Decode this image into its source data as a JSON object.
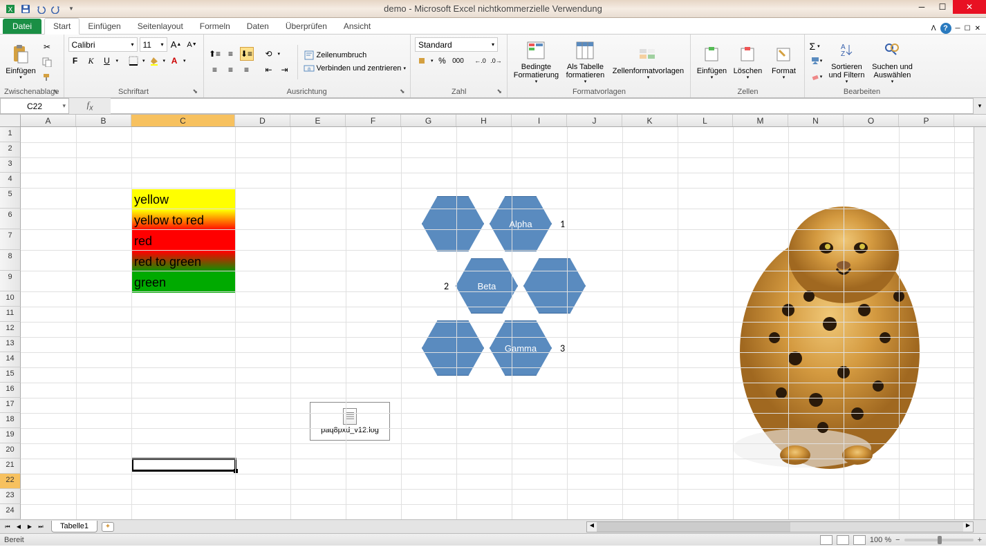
{
  "title": "demo  -  Microsoft Excel nichtkommerzielle Verwendung",
  "tabs": {
    "file": "Datei",
    "items": [
      "Start",
      "Einfügen",
      "Seitenlayout",
      "Formeln",
      "Daten",
      "Überprüfen",
      "Ansicht"
    ],
    "active": 0
  },
  "ribbon": {
    "clipboard": {
      "label": "Zwischenablage",
      "paste": "Einfügen"
    },
    "font": {
      "label": "Schriftart",
      "name": "Calibri",
      "size": "11"
    },
    "alignment": {
      "label": "Ausrichtung",
      "wrap": "Zeilenumbruch",
      "merge": "Verbinden und zentrieren"
    },
    "number": {
      "label": "Zahl",
      "format": "Standard"
    },
    "styles": {
      "label": "Formatvorlagen",
      "conditional": "Bedingte Formatierung",
      "table": "Als Tabelle formatieren",
      "cellstyles": "Zellenformatvorlagen"
    },
    "cells": {
      "label": "Zellen",
      "insert": "Einfügen",
      "delete": "Löschen",
      "format": "Format"
    },
    "editing": {
      "label": "Bearbeiten",
      "sort": "Sortieren und Filtern",
      "find": "Suchen und Auswählen"
    }
  },
  "namebox": "C22",
  "columns": [
    "A",
    "B",
    "C",
    "D",
    "E",
    "F",
    "G",
    "H",
    "I",
    "J",
    "K",
    "L",
    "M",
    "N",
    "O",
    "P"
  ],
  "rows_visible": 26,
  "selected_col": "C",
  "selected_row": 22,
  "cells": {
    "c5": "yellow",
    "c6": "yellow to red",
    "c7": "red",
    "c8": "red to green",
    "c9": "green",
    "j6": "1",
    "h10": "2",
    "j14": "3"
  },
  "hex_labels": {
    "alpha": "Alpha",
    "beta": "Beta",
    "gamma": "Gamma"
  },
  "embedded_obj": "paq8pxd_v12.log",
  "image_alt": "leopard",
  "sheet": {
    "tab1": "Tabelle1"
  },
  "status": {
    "ready": "Bereit",
    "zoom": "100 %"
  }
}
